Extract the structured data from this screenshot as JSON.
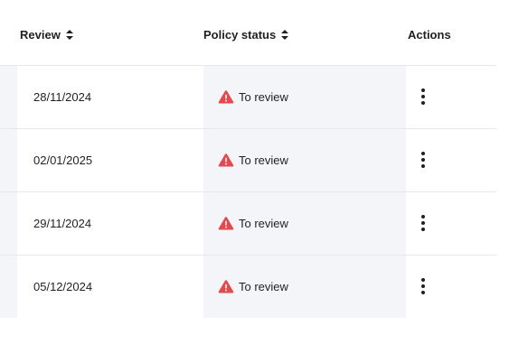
{
  "table": {
    "columns": {
      "review": "Review",
      "policy_status": "Policy status",
      "actions": "Actions"
    },
    "rows": [
      {
        "review_date": "28/11/2024",
        "policy_status": "To review"
      },
      {
        "review_date": "02/01/2025",
        "policy_status": "To review"
      },
      {
        "review_date": "29/11/2024",
        "policy_status": "To review"
      },
      {
        "review_date": "05/12/2024",
        "policy_status": "To review"
      }
    ]
  },
  "icons": {
    "sort": "sort-icon",
    "warning": "warning-triangle-icon",
    "actions": "more-vertical-icon"
  },
  "colors": {
    "warning": "#e5484d",
    "row_shade": "#f4f5f8",
    "text": "#1f2024"
  }
}
